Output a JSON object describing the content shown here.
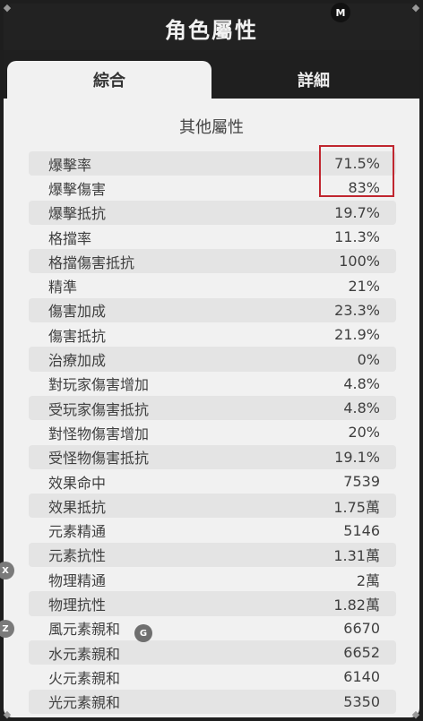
{
  "header": {
    "title": "角色屬性",
    "badge": "M"
  },
  "tabs": [
    {
      "label": "綜合",
      "active": true
    },
    {
      "label": "詳細",
      "active": false
    }
  ],
  "section": {
    "title": "其他屬性"
  },
  "rows": [
    {
      "label": "爆擊率",
      "value": "71.5%"
    },
    {
      "label": "爆擊傷害",
      "value": "83%"
    },
    {
      "label": "爆擊抵抗",
      "value": "19.7%"
    },
    {
      "label": "格擋率",
      "value": "11.3%"
    },
    {
      "label": "格擋傷害抵抗",
      "value": "100%"
    },
    {
      "label": "精準",
      "value": "21%"
    },
    {
      "label": "傷害加成",
      "value": "23.3%"
    },
    {
      "label": "傷害抵抗",
      "value": "21.9%"
    },
    {
      "label": "治療加成",
      "value": "0%"
    },
    {
      "label": "對玩家傷害增加",
      "value": "4.8%"
    },
    {
      "label": "受玩家傷害抵抗",
      "value": "4.8%"
    },
    {
      "label": "對怪物傷害增加",
      "value": "20%"
    },
    {
      "label": "受怪物傷害抵抗",
      "value": "19.1%"
    },
    {
      "label": "效果命中",
      "value": "7539"
    },
    {
      "label": "效果抵抗",
      "value": "1.75萬"
    },
    {
      "label": "元素精通",
      "value": "5146"
    },
    {
      "label": "元素抗性",
      "value": "1.31萬"
    },
    {
      "label": "物理精通",
      "value": "2萬"
    },
    {
      "label": "物理抗性",
      "value": "1.82萬"
    },
    {
      "label": "風元素親和",
      "value": "6670"
    },
    {
      "label": "水元素親和",
      "value": "6652"
    },
    {
      "label": "火元素親和",
      "value": "6140"
    },
    {
      "label": "光元素親和",
      "value": "5350"
    }
  ],
  "overlay_badges": {
    "x": "X",
    "z": "Z",
    "g": "G"
  },
  "colors": {
    "highlight": "#c0262f",
    "panel_bg": "#f1f1f1",
    "header_bg": "#222222"
  }
}
